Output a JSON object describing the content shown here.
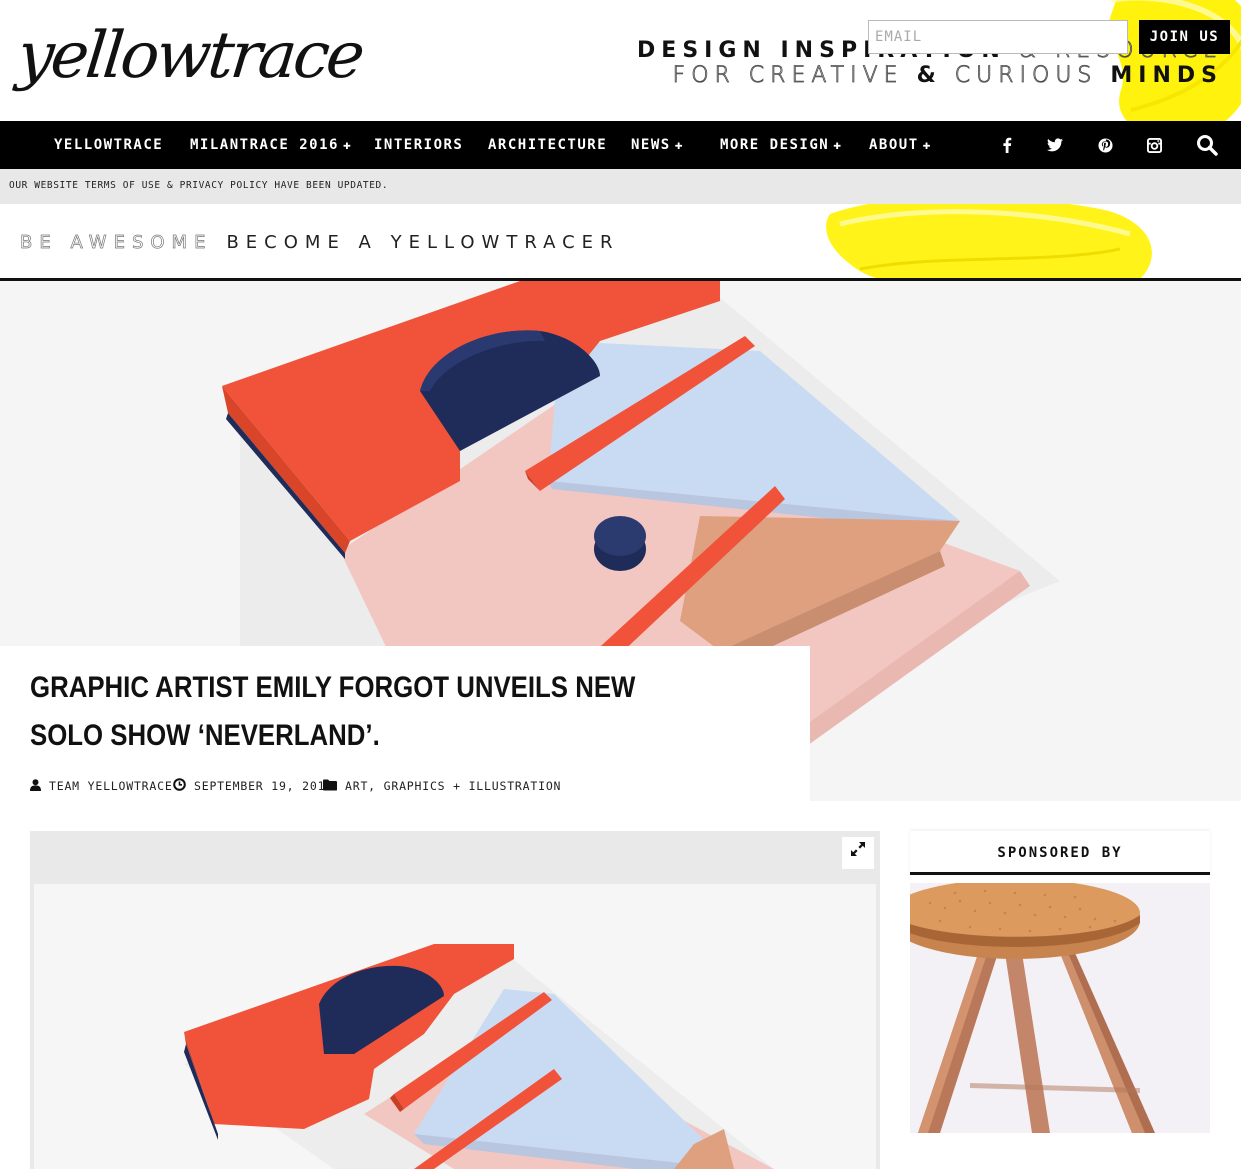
{
  "header": {
    "logo": "yellowtrace",
    "tagline_line1_bold": "DESIGN INSPIRATION",
    "tagline_line1_light": "& RESOURCE",
    "tagline_line2_light": "FOR CREATIVE",
    "tagline_line2_amp": "&",
    "tagline_line2_light2": "CURIOUS",
    "tagline_line2_bold": "MINDS",
    "accent_color": "#fff200"
  },
  "nav": {
    "items": [
      {
        "label": "YELLOWTRACE",
        "has_submenu": false
      },
      {
        "label": "MILANTRACE 2016",
        "has_submenu": true
      },
      {
        "label": "INTERIORS",
        "has_submenu": false
      },
      {
        "label": "ARCHITECTURE",
        "has_submenu": false
      },
      {
        "label": "NEWS",
        "has_submenu": true
      },
      {
        "label": "MORE DESIGN",
        "has_submenu": true
      },
      {
        "label": "ABOUT",
        "has_submenu": true
      }
    ],
    "submenu_glyph": "✚",
    "social_icons": [
      "facebook-icon",
      "twitter-icon",
      "pinterest-icon",
      "instagram-icon",
      "search-icon"
    ]
  },
  "notice": {
    "text": "OUR WEBSITE TERMS OF USE & PRIVACY POLICY HAVE BEEN UPDATED."
  },
  "subscribe": {
    "light_text": "BE AWESOME",
    "dark_text": "BECOME A YELLOWTRACER",
    "email_placeholder": "EMAIL",
    "join_label": "JOIN US"
  },
  "article": {
    "title": "GRAPHIC ARTIST EMILY FORGOT UNVEILS NEW SOLO SHOW ‘NEVERLAND’.",
    "author": "TEAM YELLOWTRACE",
    "date": "SEPTEMBER 19, 2016",
    "categories": "ART, GRAPHICS + ILLUSTRATION"
  },
  "sidebar": {
    "sponsored_label": "SPONSORED BY"
  },
  "colors": {
    "orange": "#f0533a",
    "navy": "#1f2b58",
    "pink": "#f4c6c0",
    "light_blue": "#c7dbf1",
    "tan": "#dd9f80"
  }
}
